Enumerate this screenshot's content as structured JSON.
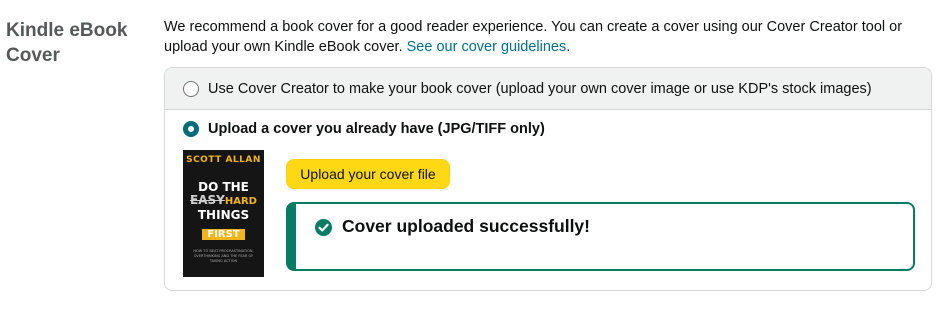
{
  "section": {
    "label": "Kindle eBook Cover"
  },
  "intro": {
    "text": "We recommend a book cover for a good reader experience. You can create a cover using our Cover Creator tool or upload your own Kindle eBook cover.",
    "link": "See our cover guidelines",
    "after_link": "."
  },
  "options": {
    "cover_creator": {
      "label": "Use Cover Creator to make your book cover (upload your own cover image or use KDP's stock images)",
      "selected": false
    },
    "upload": {
      "label": "Upload a cover you already have (JPG/TIFF only)",
      "selected": true
    }
  },
  "cover": {
    "author": "SCOTT ALLAN",
    "line1": "DO THE",
    "strike": "EASY",
    "alt": "HARD",
    "line3": "THINGS",
    "line4": "FIRST",
    "small": "HOW TO BEAT PROCRASTINATION, OVERTHINKING AND THE FEAR OF TAKING ACTION"
  },
  "upload_button": {
    "label": "Upload your cover file"
  },
  "status": {
    "message": "Cover uploaded successfully!"
  },
  "colors": {
    "accent": "#067d62",
    "link": "#007185",
    "button": "#ffd814",
    "radio": "#006b7a"
  }
}
